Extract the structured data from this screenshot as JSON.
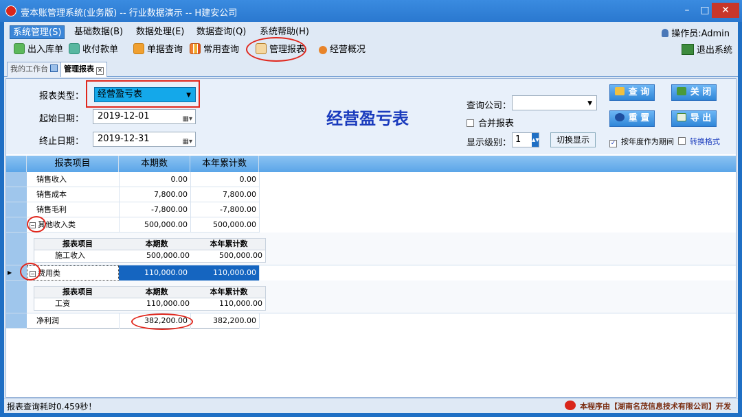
{
  "window": {
    "title": "壹本账管理系统(业务版) -- 行业数据演示 -- H建安公司",
    "min_glyph": "–",
    "max_glyph": "□",
    "close_glyph": "✕"
  },
  "menu": {
    "items": [
      "系统管理(S)",
      "基础数据(B)",
      "数据处理(E)",
      "数据查询(Q)",
      "系统帮助(H)"
    ],
    "operator": "操作员:Admin"
  },
  "toolbar": {
    "items": [
      "出入库单",
      "收付款单",
      "单据查询",
      "常用查询",
      "管理报表",
      "经营概况"
    ],
    "exit": "退出系统"
  },
  "tabs": [
    "我的工作台",
    "管理报表"
  ],
  "form": {
    "report_type_label": "报表类型：",
    "report_type_value": "经营盈亏表",
    "start_label": "起始日期：",
    "start_value": "2019-12-01",
    "end_label": "终止日期：",
    "end_value": "2019-12-31",
    "report_title": "经营盈亏表",
    "company_label": "查询公司：",
    "company_value": "",
    "merge_label": "合并报表",
    "level_label": "显示级别：",
    "level_value": "1",
    "switch_label": "切换显示",
    "year_period_label": "按年度作为期间",
    "convert_label": "转换格式",
    "btn_query": "查 询",
    "btn_close": "关 闭",
    "btn_reset": "重 置",
    "btn_export": "导 出"
  },
  "grid": {
    "headers": [
      "报表项目",
      "本期数",
      "本年累计数"
    ],
    "rows": [
      {
        "item": "销售收入",
        "current": "0.00",
        "ytd": "0.00"
      },
      {
        "item": "销售成本",
        "current": "7,800.00",
        "ytd": "7,800.00"
      },
      {
        "item": "销售毛利",
        "current": "-7,800.00",
        "ytd": "-7,800.00"
      },
      {
        "item": "其他收入类",
        "current": "500,000.00",
        "ytd": "500,000.00"
      },
      {
        "item": "费用类",
        "current": "110,000.00",
        "ytd": "110,000.00"
      },
      {
        "item": "净利润",
        "current": "382,200.00",
        "ytd": "382,200.00"
      }
    ],
    "sub_headers": [
      "报表项目",
      "本期数",
      "本年累计数"
    ],
    "detail_income": {
      "item": "施工收入",
      "current": "500,000.00",
      "ytd": "500,000.00"
    },
    "detail_expense": {
      "item": "工资",
      "current": "110,000.00",
      "ytd": "110,000.00"
    },
    "expander_glyph": "−",
    "row_pointer": "▶"
  },
  "status": {
    "text": "报表查询耗时0.459秒！",
    "credit": "本程序由【湖南名茂信息技术有限公司】开发"
  }
}
